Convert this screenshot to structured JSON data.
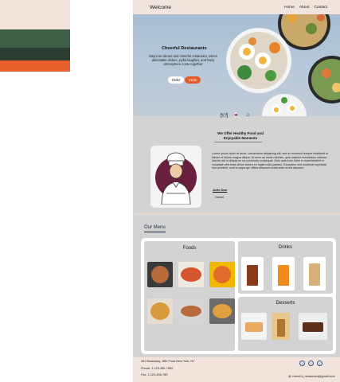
{
  "palette": [
    "#f2e4dc",
    "#3e5e48",
    "#2b3d31",
    "#e8612c"
  ],
  "nav": {
    "brand": "Welcome",
    "links": [
      "Home",
      "About",
      "Contact"
    ]
  },
  "hero": {
    "title": "Cheerful Restaurants",
    "text": "Step into vibrant and cheerful restaurant, where delectable dishes, joyful laughter, and lively atmosphere come together",
    "order_label": "Order",
    "visit_label": "Visits"
  },
  "features": {
    "icons": [
      "dining-icon",
      "grape-icon",
      "building-icon"
    ]
  },
  "about": {
    "title_line1": "We Offer Healthy Food and",
    "title_line2": "Enjoyable Moments",
    "text": "Lorem ipsum dolor sit amet, consectetur adipiscing elit, sed do eiusmod tempor incididunt ut labore et dolore magna aliqua. Ut enim ad minim veniam, quis nostrud exercitation ullamco laboris nisi ut aliquip ex ea commodo consequat. Duis aute irure dolor in reprehenderit in voluptate velit esse cillum dolore eu fugiat nulla pariatur. Excepteur sint occaecat cupidatat non proident, sunt in culpa qui officia deserunt mollit anim id est laborum.",
    "signature": "John Doe",
    "role": "Owner"
  },
  "menu": {
    "title": "Our Menu",
    "foods_title": "Foods",
    "drinks_title": "Drinks",
    "desserts_title": "Desserts"
  },
  "footer": {
    "address": "401 Broadway, 18th Floor New York, NY",
    "phone": "Phone: 1-123-456-7890",
    "fax": "Fax: 1-123-456-789",
    "email": "cheerful_restaurant@gmail.com",
    "social": [
      "f",
      "t",
      "i"
    ]
  }
}
